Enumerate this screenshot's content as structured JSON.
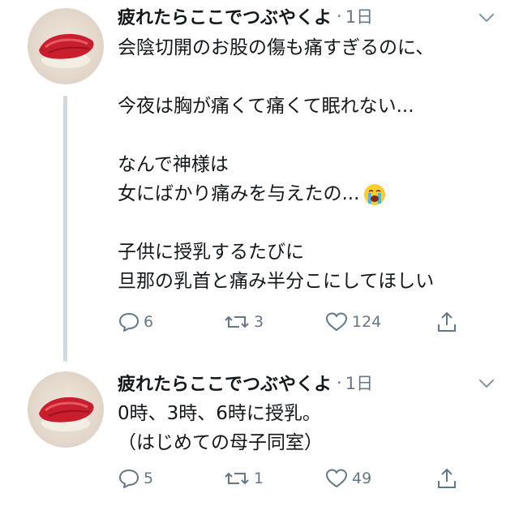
{
  "tweets": [
    {
      "author": "疲れたらここでつぶやくよ",
      "separator": "·",
      "time": "1日",
      "lines": [
        "会陰切開のお股の傷も痛すぎるのに、",
        "",
        "今夜は胸が痛くて痛くて眠れない...",
        "",
        "なんで神様は",
        "女にばかり痛みを与えたの...",
        "",
        "子供に授乳するたびに",
        "旦那の乳首と痛み半分こにしてほしい"
      ],
      "emoji": "loudly-crying-face",
      "replies": "6",
      "retweets": "3",
      "likes": "124"
    },
    {
      "author": "疲れたらここでつぶやくよ",
      "separator": "·",
      "time": "1日",
      "lines": [
        "0時、3時、6時に授乳。",
        "（はじめての母子同室）"
      ],
      "replies": "5",
      "retweets": "1",
      "likes": "49"
    }
  ],
  "colors": {
    "text": "#14171a",
    "secondary": "#657786",
    "thread_line": "#cfd9de"
  }
}
